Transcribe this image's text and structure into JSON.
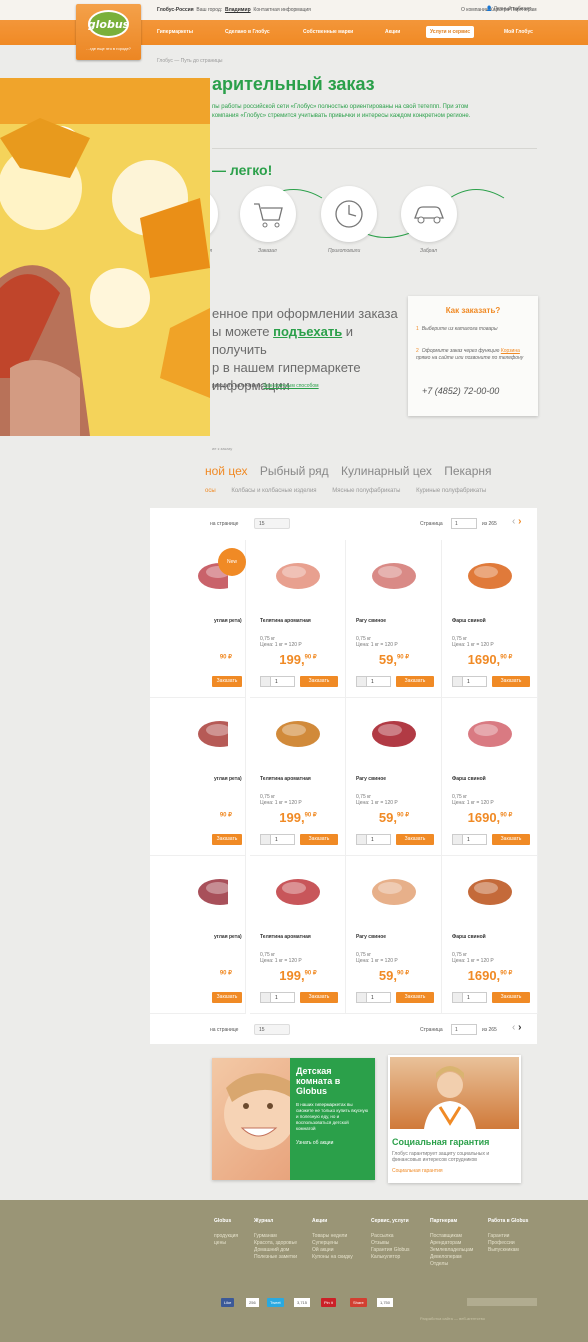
{
  "topbar": {
    "region_label": "Глобус-Россия",
    "city_prefix": "Ваш город:",
    "city": "Владимир",
    "contacts": "Контактная информация",
    "right_links": "О компании  Карьера  Партнерам",
    "account": "Личный кабинет"
  },
  "logo": {
    "word": "globus",
    "tagline": "…где еще это в городе?"
  },
  "nav": [
    {
      "label": "Гипермаркеты"
    },
    {
      "label": "Сделано в Глобус"
    },
    {
      "label": "Собственные марки"
    },
    {
      "label": "Акции"
    },
    {
      "label": "Услуги и сервис",
      "active": true
    },
    {
      "label": "Мой Глобус"
    }
  ],
  "breadcrumb": "Глобус — Путь до страницы",
  "page": {
    "title": "арительный заказ",
    "intro": "пы работы российской сети «Глобус» полностью ориентированы на свой тетеппп. При этом компания «Глобус» стремится учитывать привычки и интересы каждом конкретном регионе.",
    "easy": "— легко!"
  },
  "steps": [
    {
      "label": "лся"
    },
    {
      "label": "Заказал"
    },
    {
      "label": "Приготовили"
    },
    {
      "label": "Забрал"
    }
  ],
  "promo": {
    "line1": "енное при оформлении заказа",
    "line2a": "ы можете ",
    "line2b": "подъехать",
    "line2c": " и получить",
    "line3": "р в нашем гипермаркете",
    "line4": " информации",
    "foot_a": "роводить наличные и ",
    "foot_b": "безналичным способом"
  },
  "howto": {
    "title": "Как заказать?",
    "step1": "Выберите из каталога товары",
    "step2a": "Оформите заказ через функцию ",
    "step2b": "Корзина",
    "step2c": " прямо на сайте или позвоните по телефону",
    "phone": "+7 (4852) 72-00-00"
  },
  "catalog": {
    "caption": "ие к заказу",
    "tabs": [
      "ной цех",
      "Рыбный ряд",
      "Кулинарный цех",
      "Пекарня"
    ],
    "subtabs": [
      "осы",
      "Колбасы и колбасные изделия",
      "Мясные полуфабрикаты",
      "Куриные полуфабрикаты"
    ],
    "per_page_label": "на странице",
    "per_page_top": "15",
    "per_page_bottom": "15",
    "page_label": "Страница",
    "page_value": "1",
    "of_label": "из 265",
    "badge": "New",
    "buy_label": "Заказать",
    "qty_value": "1"
  },
  "products": [
    {
      "name": "углая рета)",
      "weight": "",
      "unit_price": "",
      "price_int": "",
      "price_frac": "90",
      "partial": true
    },
    {
      "name": "Телятина ароматная",
      "weight": "0,75 кг",
      "unit_price": "Цена: 1 кг = 120 Р",
      "price_int": "199,",
      "price_frac": "90",
      "partial": false
    },
    {
      "name": "Рагу свиное",
      "weight": "0,75 кг",
      "unit_price": "Цена: 1 кг = 120 Р",
      "price_int": "59,",
      "price_frac": "90",
      "partial": false
    },
    {
      "name": "Фарш свиной",
      "weight": "0,75 кг",
      "unit_price": "Цена: 1 кг = 120 Р",
      "price_int": "1690,",
      "price_frac": "90",
      "partial": false
    },
    {
      "name": "углая рета)",
      "weight": "",
      "unit_price": "",
      "price_int": "",
      "price_frac": "90",
      "partial": true
    },
    {
      "name": "Телятина ароматная",
      "weight": "0,75 кг",
      "unit_price": "Цена: 1 кг = 120 Р",
      "price_int": "199,",
      "price_frac": "90",
      "partial": false
    },
    {
      "name": "Рагу свиное",
      "weight": "0,75 кг",
      "unit_price": "Цена: 1 кг = 120 Р",
      "price_int": "59,",
      "price_frac": "90",
      "partial": false
    },
    {
      "name": "Фарш свиной",
      "weight": "0,75 кг",
      "unit_price": "Цена: 1 кг = 120 Р",
      "price_int": "1690,",
      "price_frac": "90",
      "partial": false
    },
    {
      "name": "углая рета)",
      "weight": "",
      "unit_price": "",
      "price_int": "",
      "price_frac": "90",
      "partial": true
    },
    {
      "name": "Телятина ароматная",
      "weight": "0,75 кг",
      "unit_price": "Цена: 1 кг = 120 Р",
      "price_int": "199,",
      "price_frac": "90",
      "partial": false
    },
    {
      "name": "Рагу свиное",
      "weight": "0,75 кг",
      "unit_price": "Цена: 1 кг = 120 Р",
      "price_int": "59,",
      "price_frac": "90",
      "partial": false
    },
    {
      "name": "Фарш свиной",
      "weight": "0,75 кг",
      "unit_price": "Цена: 1 кг = 120 Р",
      "price_int": "1690,",
      "price_frac": "90",
      "partial": false
    }
  ],
  "banners": {
    "kids_title": "Детская комната в Globus",
    "kids_text": "В наших гипермаркетах вы сможете не только купить вкусную и полезную еду, но и воспользоваться детской комнатой",
    "kids_link": "Узнать об акции",
    "social_title": "Социальная гарантия",
    "social_text": "Глобус гарантирует защиту социальных и финансовых интересов сотрудников",
    "social_link": "Социальная гарантия"
  },
  "footer": {
    "cols": [
      {
        "title": "Globus",
        "items": "продукция\nцены"
      },
      {
        "title": "Журнал",
        "items": "Гурманам\nКрасота, здоровье\nДомашний дом\nПолезные заметки"
      },
      {
        "title": "Акции",
        "items": "Товары недели\nСуперцены\nОй акции\nКупоны на скидку"
      },
      {
        "title": "Сервис, услуги",
        "items": "Рассылка\nОтзывы\nГарантия Globus\nКалькулятор"
      },
      {
        "title": "Партнерам",
        "items": "Поставщикам\nАрендаторам\nЗемлевладельцам\nДевелоперам\nОтделы"
      },
      {
        "title": "Работа в Globus",
        "items": "Гарантии\nПрофессии\nВыпускникам"
      }
    ],
    "social": [
      {
        "label": "Like",
        "count": "256",
        "color": "#3b5998"
      },
      {
        "label": "Tweet",
        "count": "3,715",
        "color": "#2aa9e0"
      },
      {
        "label": "Pin it",
        "count": "",
        "color": "#cb2027"
      },
      {
        "label": "Share",
        "count": "1,750",
        "color": "#d23f31"
      }
    ],
    "copyright": "Разработка сайта — веб-агентство"
  }
}
